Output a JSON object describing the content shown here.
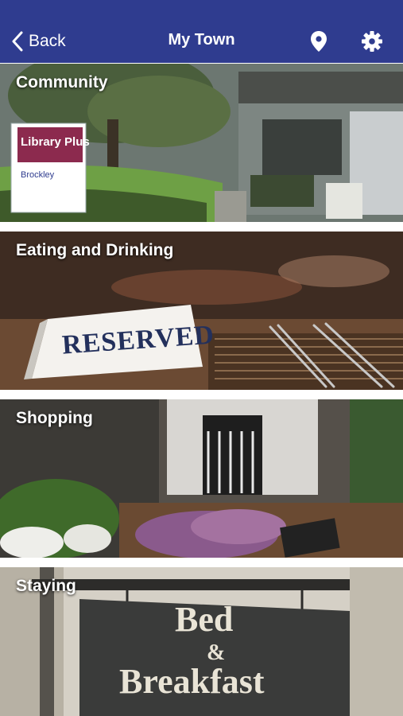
{
  "nav": {
    "back_label": "Back",
    "title": "My Town",
    "location_icon": "map-pin-icon",
    "settings_icon": "gear-icon",
    "background": "#2f3c8f"
  },
  "tiles": [
    {
      "label": "Community",
      "sign_top": "Library Plus",
      "sign_sub": "Brockley"
    },
    {
      "label": "Eating and Drinking",
      "sign": "RESERVED"
    },
    {
      "label": "Shopping"
    },
    {
      "label": "Staying",
      "sign_line1": "Bed",
      "sign_line2": "&",
      "sign_line3": "Breakfast"
    }
  ]
}
